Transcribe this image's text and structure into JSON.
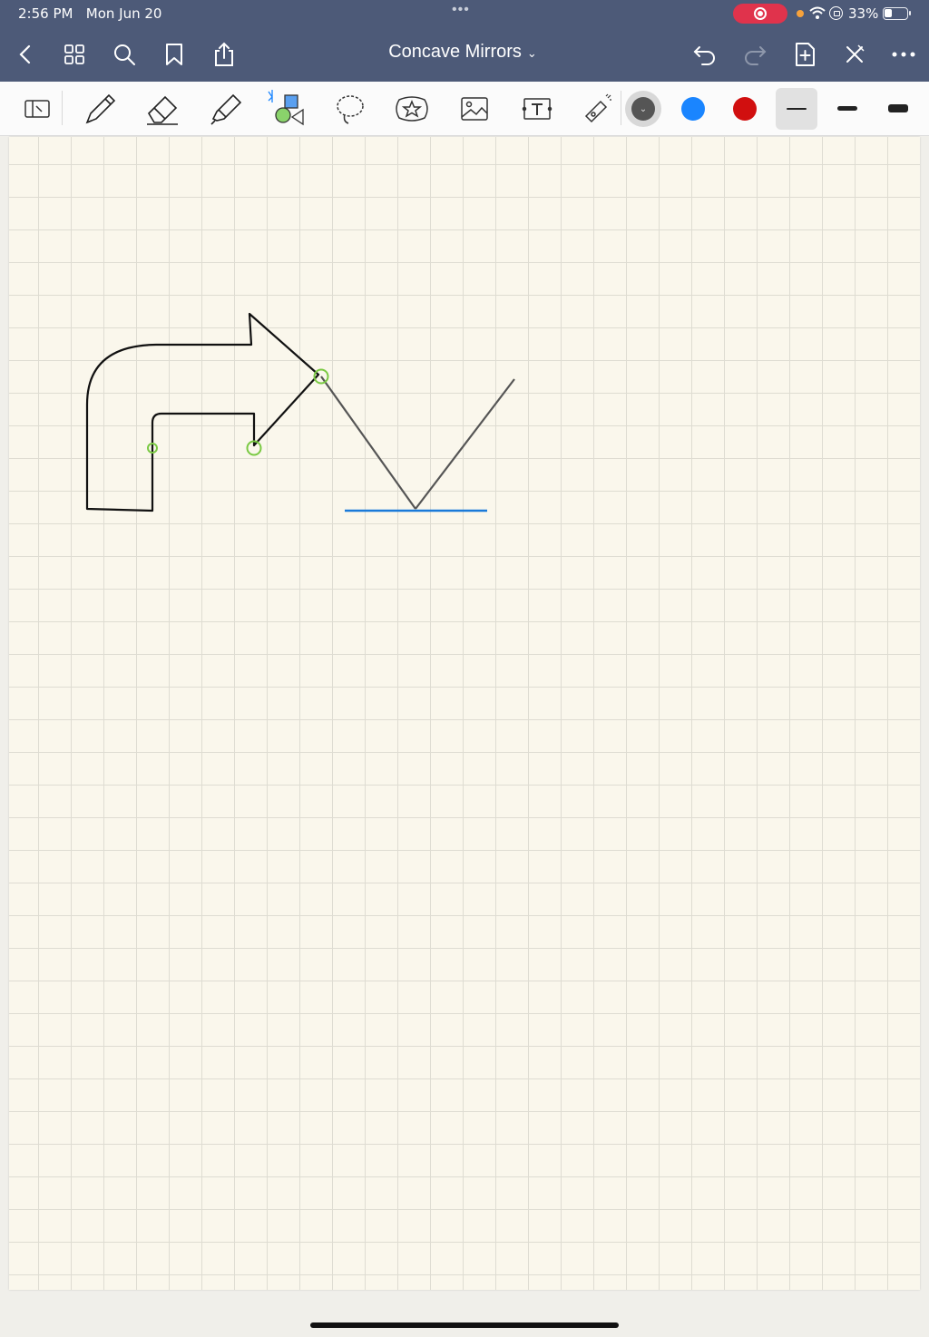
{
  "status_bar": {
    "time": "2:56 PM",
    "date": "Mon Jun 20",
    "battery": "33%",
    "multitask_dots": "•••"
  },
  "nav": {
    "title": "Concave Mirrors",
    "title_chevron": "⌄"
  },
  "toolbar": {
    "tools": [
      "read-only-mode",
      "pen",
      "eraser",
      "highlighter",
      "shapes",
      "lasso",
      "elements",
      "image",
      "text",
      "laser-pointer"
    ],
    "colors": [
      "#555555",
      "#1a85ff",
      "#d10f0f"
    ],
    "selected_color": "#555555",
    "thicknesses": [
      "thin",
      "medium",
      "thick"
    ],
    "selected_thickness": "thin"
  },
  "canvas": {
    "stroke_colors": {
      "ink": "#111111",
      "ray": "#555555",
      "mirror": "#1a7ad9",
      "lasso_handle": "#7ac943"
    },
    "background": "#faf7ec",
    "grid": true
  }
}
